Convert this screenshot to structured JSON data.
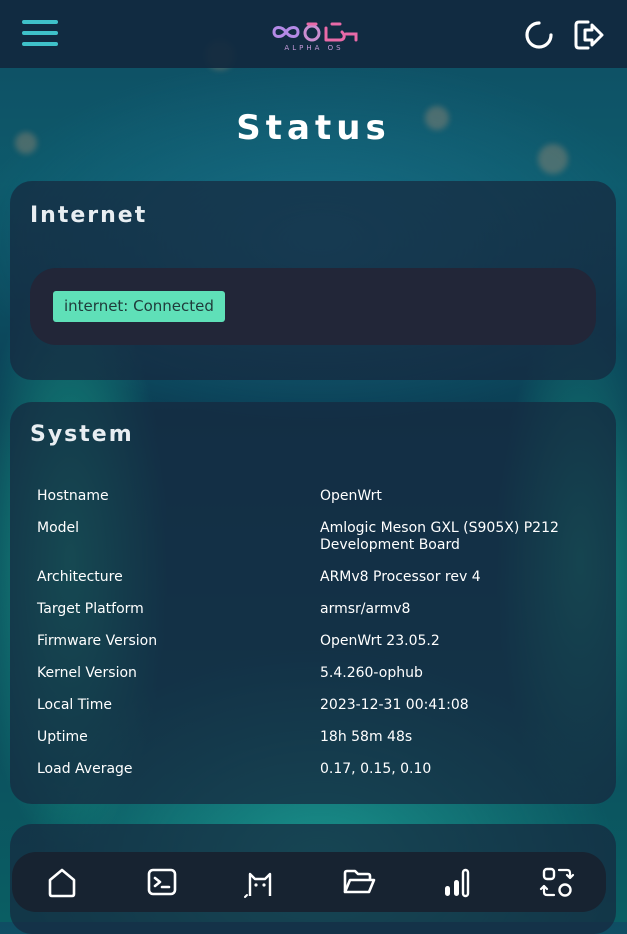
{
  "header": {
    "logo_text": "ALPHA OS"
  },
  "page": {
    "title": "Status"
  },
  "internet": {
    "title": "Internet",
    "status_badge": "internet: Connected"
  },
  "system": {
    "title": "System",
    "rows": [
      {
        "label": "Hostname",
        "value": "OpenWrt"
      },
      {
        "label": "Model",
        "value": "Amlogic Meson GXL (S905X) P212 Development Board"
      },
      {
        "label": "Architecture",
        "value": "ARMv8 Processor rev 4"
      },
      {
        "label": "Target Platform",
        "value": "armsr/armv8"
      },
      {
        "label": "Firmware Version",
        "value": "OpenWrt 23.05.2"
      },
      {
        "label": "Kernel Version",
        "value": "5.4.260-ophub"
      },
      {
        "label": "Local Time",
        "value": "2023-12-31 00:41:08"
      },
      {
        "label": "Uptime",
        "value": "18h 58m 48s"
      },
      {
        "label": "Load Average",
        "value": "0.17, 0.15, 0.10"
      }
    ]
  },
  "nav": {
    "items": [
      "home-icon",
      "terminal-icon",
      "cat-icon",
      "folder-open-icon",
      "signal-bars-icon",
      "swap-icon"
    ]
  },
  "colors": {
    "accent": "#3fc1c9",
    "badge_bg": "#5fe0b8",
    "logo_pink": "#e96aa8",
    "logo_purple": "#b48ae6"
  }
}
